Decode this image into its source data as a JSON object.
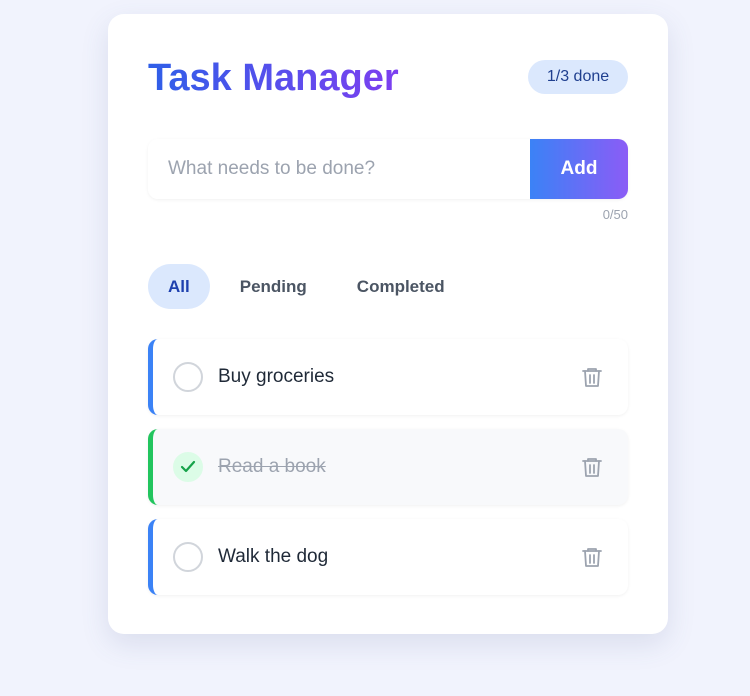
{
  "app": {
    "title": "Task Manager",
    "progress_badge": "1/3 done"
  },
  "input": {
    "placeholder": "What needs to be done?",
    "value": "",
    "add_label": "Add",
    "char_counter": "0/50"
  },
  "filters": [
    {
      "label": "All",
      "active": true
    },
    {
      "label": "Pending",
      "active": false
    },
    {
      "label": "Completed",
      "active": false
    }
  ],
  "tasks": [
    {
      "text": "Buy groceries",
      "completed": false,
      "icon": "trash-icon"
    },
    {
      "text": "Read a book",
      "completed": true,
      "icon": "trash-icon"
    },
    {
      "text": "Walk the dog",
      "completed": false,
      "icon": "trash-icon"
    }
  ],
  "colors": {
    "accent_blue": "#3b82f6",
    "accent_purple": "#8b5cf6",
    "done_green": "#22c55e",
    "badge_bg": "#dbe8fd"
  }
}
